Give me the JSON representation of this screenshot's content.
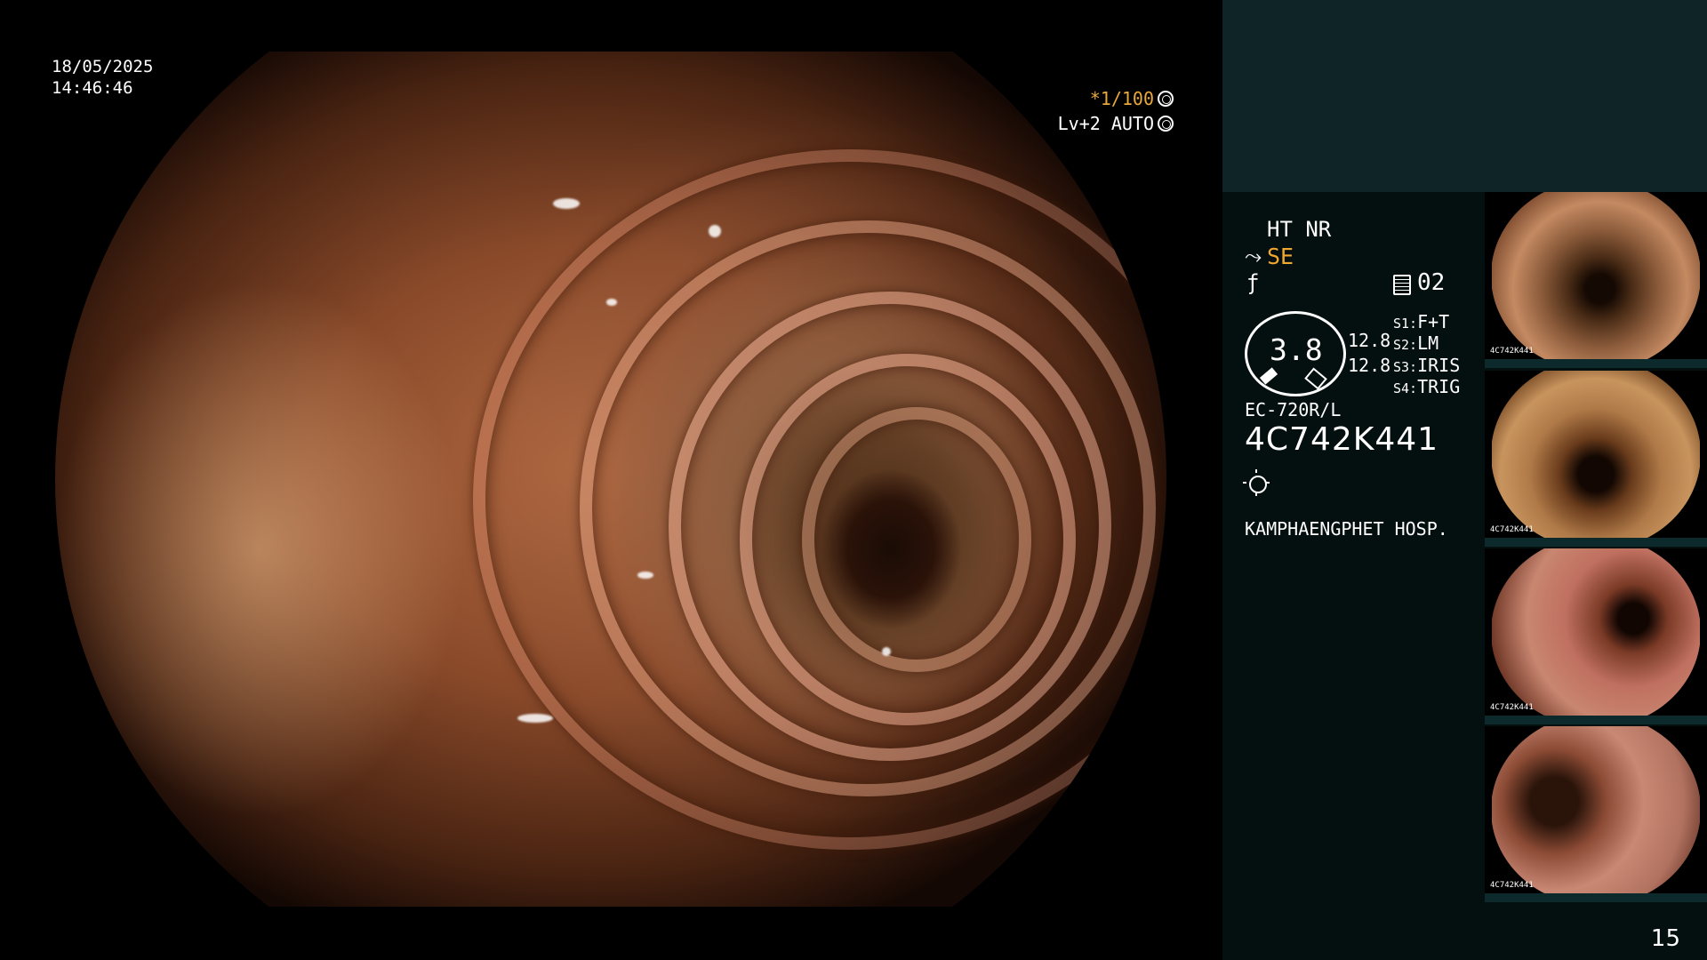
{
  "overlay": {
    "date": "18/05/2025",
    "time": "14:46:46",
    "shutter": "*1/100",
    "level": "Lv+2 AUTO"
  },
  "panel": {
    "mode": "HT NR",
    "enhance": "SE",
    "channel": "02",
    "gauge_value": "3.8",
    "value_a": "12.8",
    "value_b": "12.8",
    "switches": [
      {
        "key": "S1:",
        "value": "F+T"
      },
      {
        "key": "S2:",
        "value": "LM"
      },
      {
        "key": "S3:",
        "value": "IRIS"
      },
      {
        "key": "S4:",
        "value": "TRIG"
      }
    ],
    "scope_model": "EC-720R/L",
    "serial": "4C742K441",
    "hospital": "KAMPHAENGPHET HOSP."
  },
  "thumbnails": {
    "id_label": "4C742K441"
  },
  "page_number": "15",
  "icons": {
    "shutter": "aperture-icon",
    "level": "ring-icon",
    "enhance": "structure-enhance-icon",
    "f": "f-icon",
    "channel": "document-icon",
    "light": "sun-icon"
  },
  "colors": {
    "accent_orange": "#f0a830",
    "panel_top": "#0e2426",
    "panel": "#040f10"
  }
}
